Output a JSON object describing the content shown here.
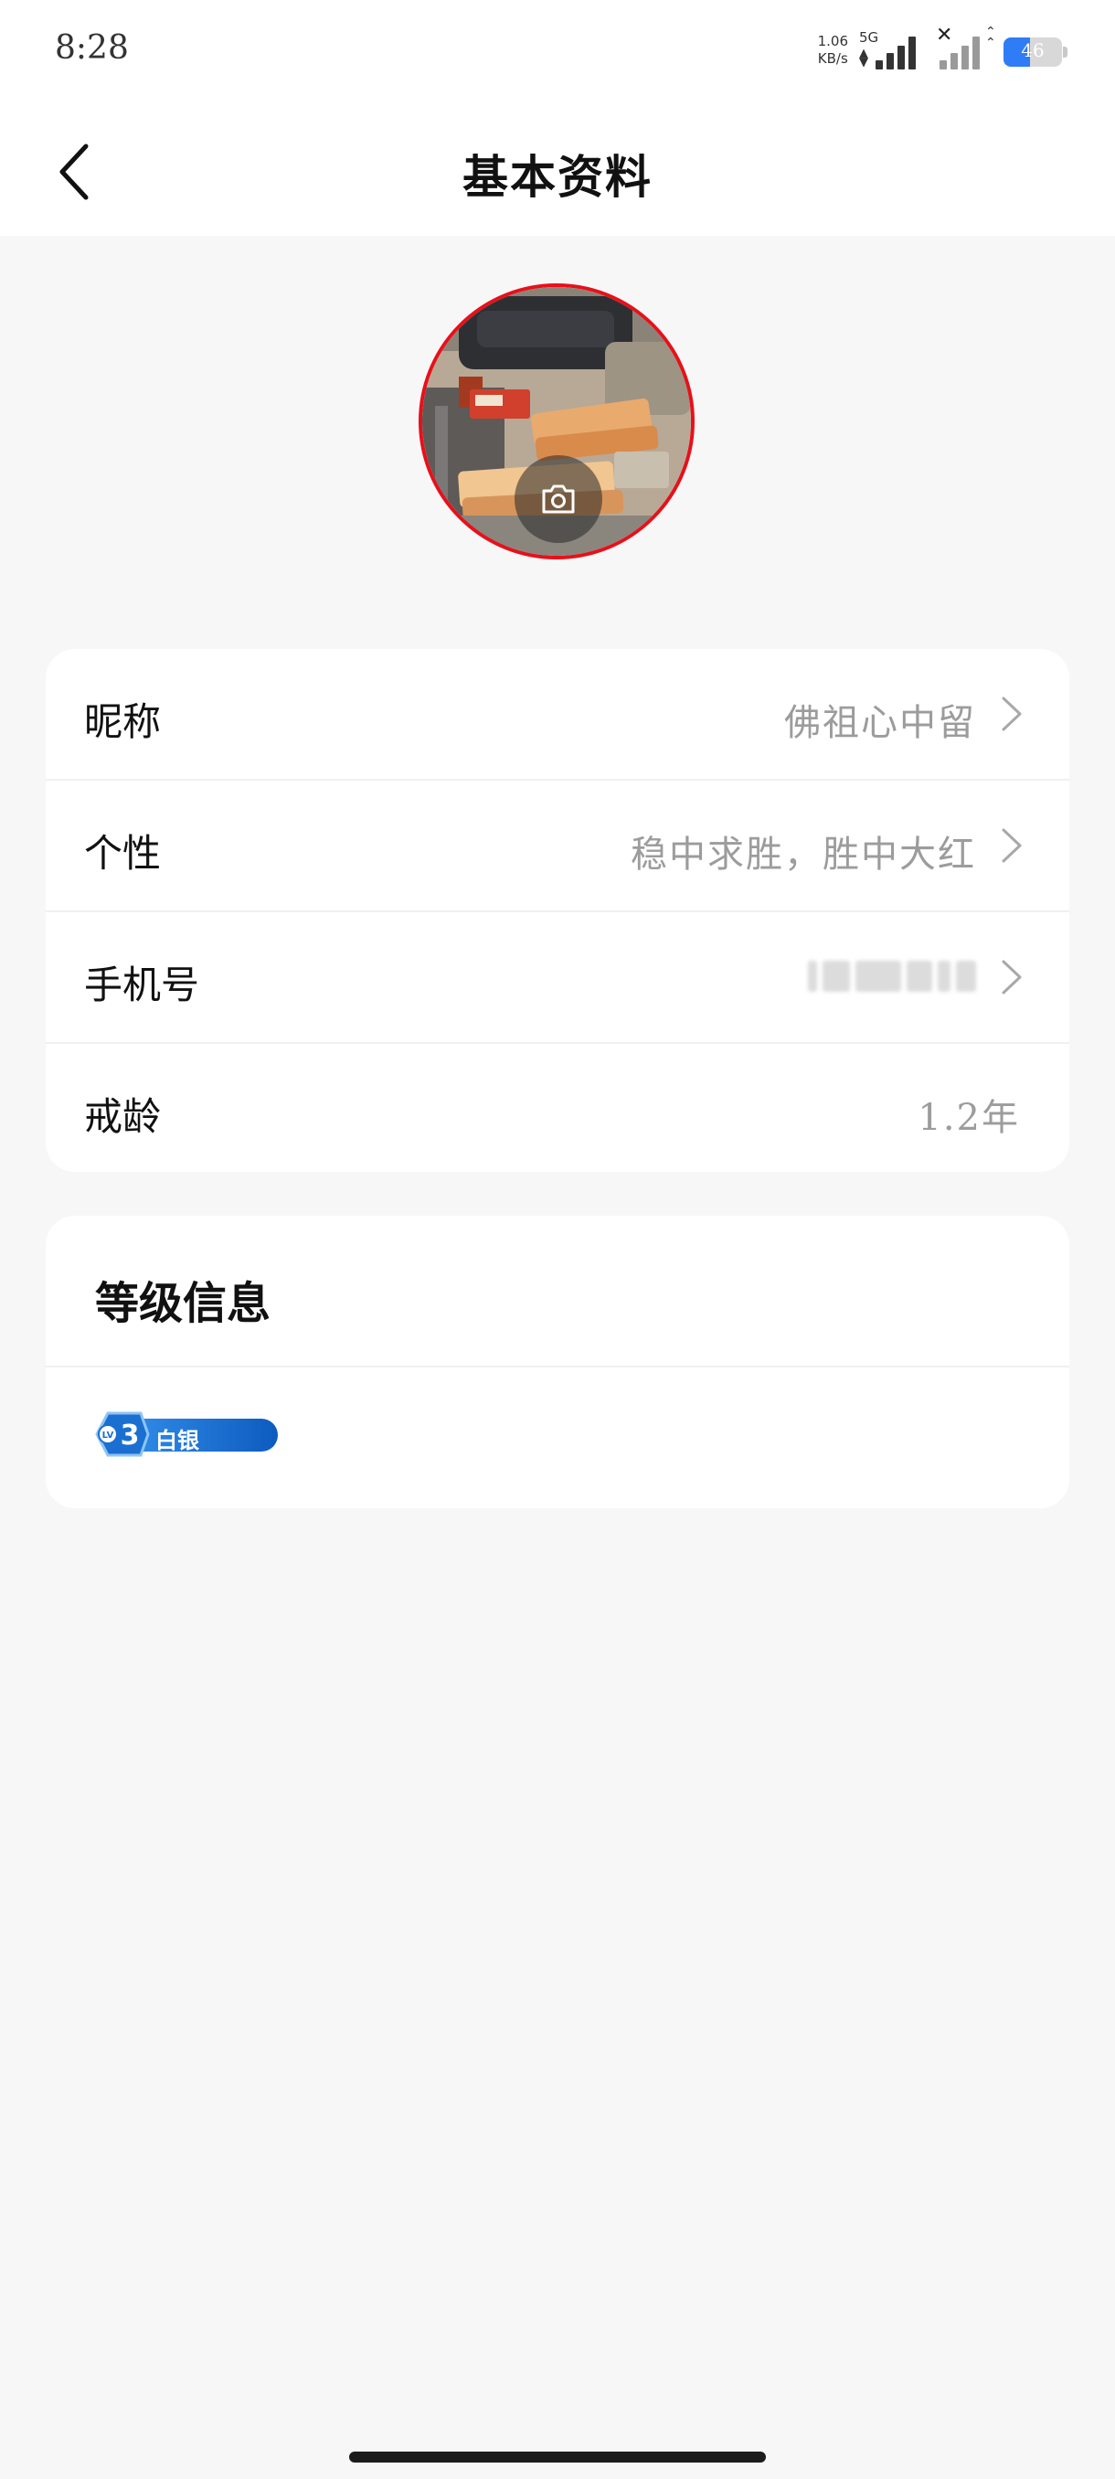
{
  "status_bar": {
    "time": "8:28",
    "net_speed_value": "1.06",
    "net_speed_unit": "KB/s",
    "network_type": "5G",
    "battery_level": "46"
  },
  "nav": {
    "title": "基本资料",
    "back_icon": "back-arrow-icon"
  },
  "avatar": {
    "camera_icon": "camera-icon"
  },
  "profile": {
    "rows": [
      {
        "label": "昵称",
        "value": "佛祖心中留",
        "has_arrow": true
      },
      {
        "label": "个性",
        "value": "稳中求胜，胜中大红",
        "has_arrow": true
      },
      {
        "label": "手机号",
        "value": "",
        "has_arrow": true,
        "blurred": true
      },
      {
        "label": "戒龄",
        "value": "1.2年",
        "has_arrow": false
      }
    ]
  },
  "level": {
    "title": "等级信息",
    "badge_level": "3",
    "badge_prefix": "LV",
    "badge_text": "白银",
    "badge_color": "#1a6fd1"
  }
}
